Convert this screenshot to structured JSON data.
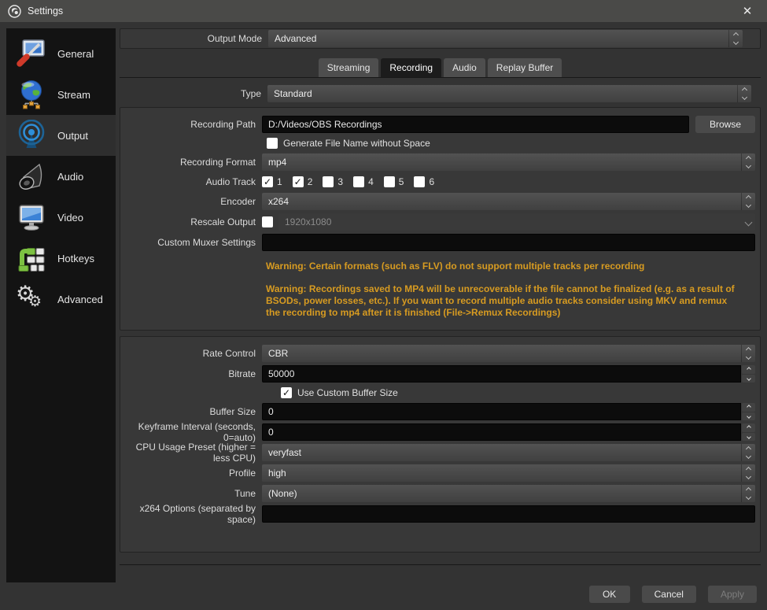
{
  "window": {
    "title": "Settings",
    "close_glyph": "✕"
  },
  "sidebar": {
    "selected": "Output",
    "items": [
      {
        "label": "General"
      },
      {
        "label": "Stream"
      },
      {
        "label": "Output"
      },
      {
        "label": "Audio"
      },
      {
        "label": "Video"
      },
      {
        "label": "Hotkeys"
      },
      {
        "label": "Advanced"
      }
    ]
  },
  "output_mode": {
    "label": "Output Mode",
    "value": "Advanced"
  },
  "tabs": {
    "streaming": "Streaming",
    "recording": "Recording",
    "audio": "Audio",
    "replay": "Replay Buffer",
    "selected": "Recording"
  },
  "recording": {
    "type": {
      "label": "Type",
      "value": "Standard"
    },
    "path": {
      "label": "Recording Path",
      "value": "D:/Videos/OBS Recordings",
      "browse_label": "Browse"
    },
    "no_space": {
      "label": "Generate File Name without Space",
      "glyph": ""
    },
    "format": {
      "label": "Recording Format",
      "value": "mp4"
    },
    "audio_track": {
      "label": "Audio Track",
      "tracks": [
        {
          "n": "1",
          "glyph": "✓"
        },
        {
          "n": "2",
          "glyph": "✓"
        },
        {
          "n": "3",
          "glyph": ""
        },
        {
          "n": "4",
          "glyph": ""
        },
        {
          "n": "5",
          "glyph": ""
        },
        {
          "n": "6",
          "glyph": ""
        }
      ]
    },
    "encoder": {
      "label": "Encoder",
      "value": "x264"
    },
    "rescale": {
      "label": "Rescale Output",
      "glyph": "",
      "value": "1920x1080"
    },
    "muxer": {
      "label": "Custom Muxer Settings",
      "value": ""
    },
    "warning1": "Warning: Certain formats (such as FLV) do not support multiple tracks per recording",
    "warning2": "Warning: Recordings saved to MP4 will be unrecoverable if the file cannot be finalized (e.g. as a result of BSODs, power losses, etc.). If you want to record multiple audio tracks consider using MKV and remux the recording to mp4 after it is finished (File->Remux Recordings)"
  },
  "encoder_settings": {
    "rate_control": {
      "label": "Rate Control",
      "value": "CBR"
    },
    "bitrate": {
      "label": "Bitrate",
      "value": "50000"
    },
    "custom_buffer": {
      "label": "Use Custom Buffer Size",
      "glyph": "✓"
    },
    "buffer_size": {
      "label": "Buffer Size",
      "value": "0"
    },
    "keyframe": {
      "label": "Keyframe Interval (seconds, 0=auto)",
      "value": "0"
    },
    "cpu_preset": {
      "label": "CPU Usage Preset (higher = less CPU)",
      "value": "veryfast"
    },
    "profile": {
      "label": "Profile",
      "value": "high"
    },
    "tune": {
      "label": "Tune",
      "value": "(None)"
    },
    "x264_options": {
      "label": "x264 Options (separated by space)",
      "value": ""
    }
  },
  "footer": {
    "ok": "OK",
    "cancel": "Cancel",
    "apply": "Apply"
  },
  "colors": {
    "warning_text": "#d79b21",
    "titlebar": "#4a4a48",
    "sidebar_bg": "#131313",
    "selected_item_bg": "#2e2e2e",
    "input_bg": "#0c0c0c",
    "checkbox_bg": "#ffffff"
  }
}
